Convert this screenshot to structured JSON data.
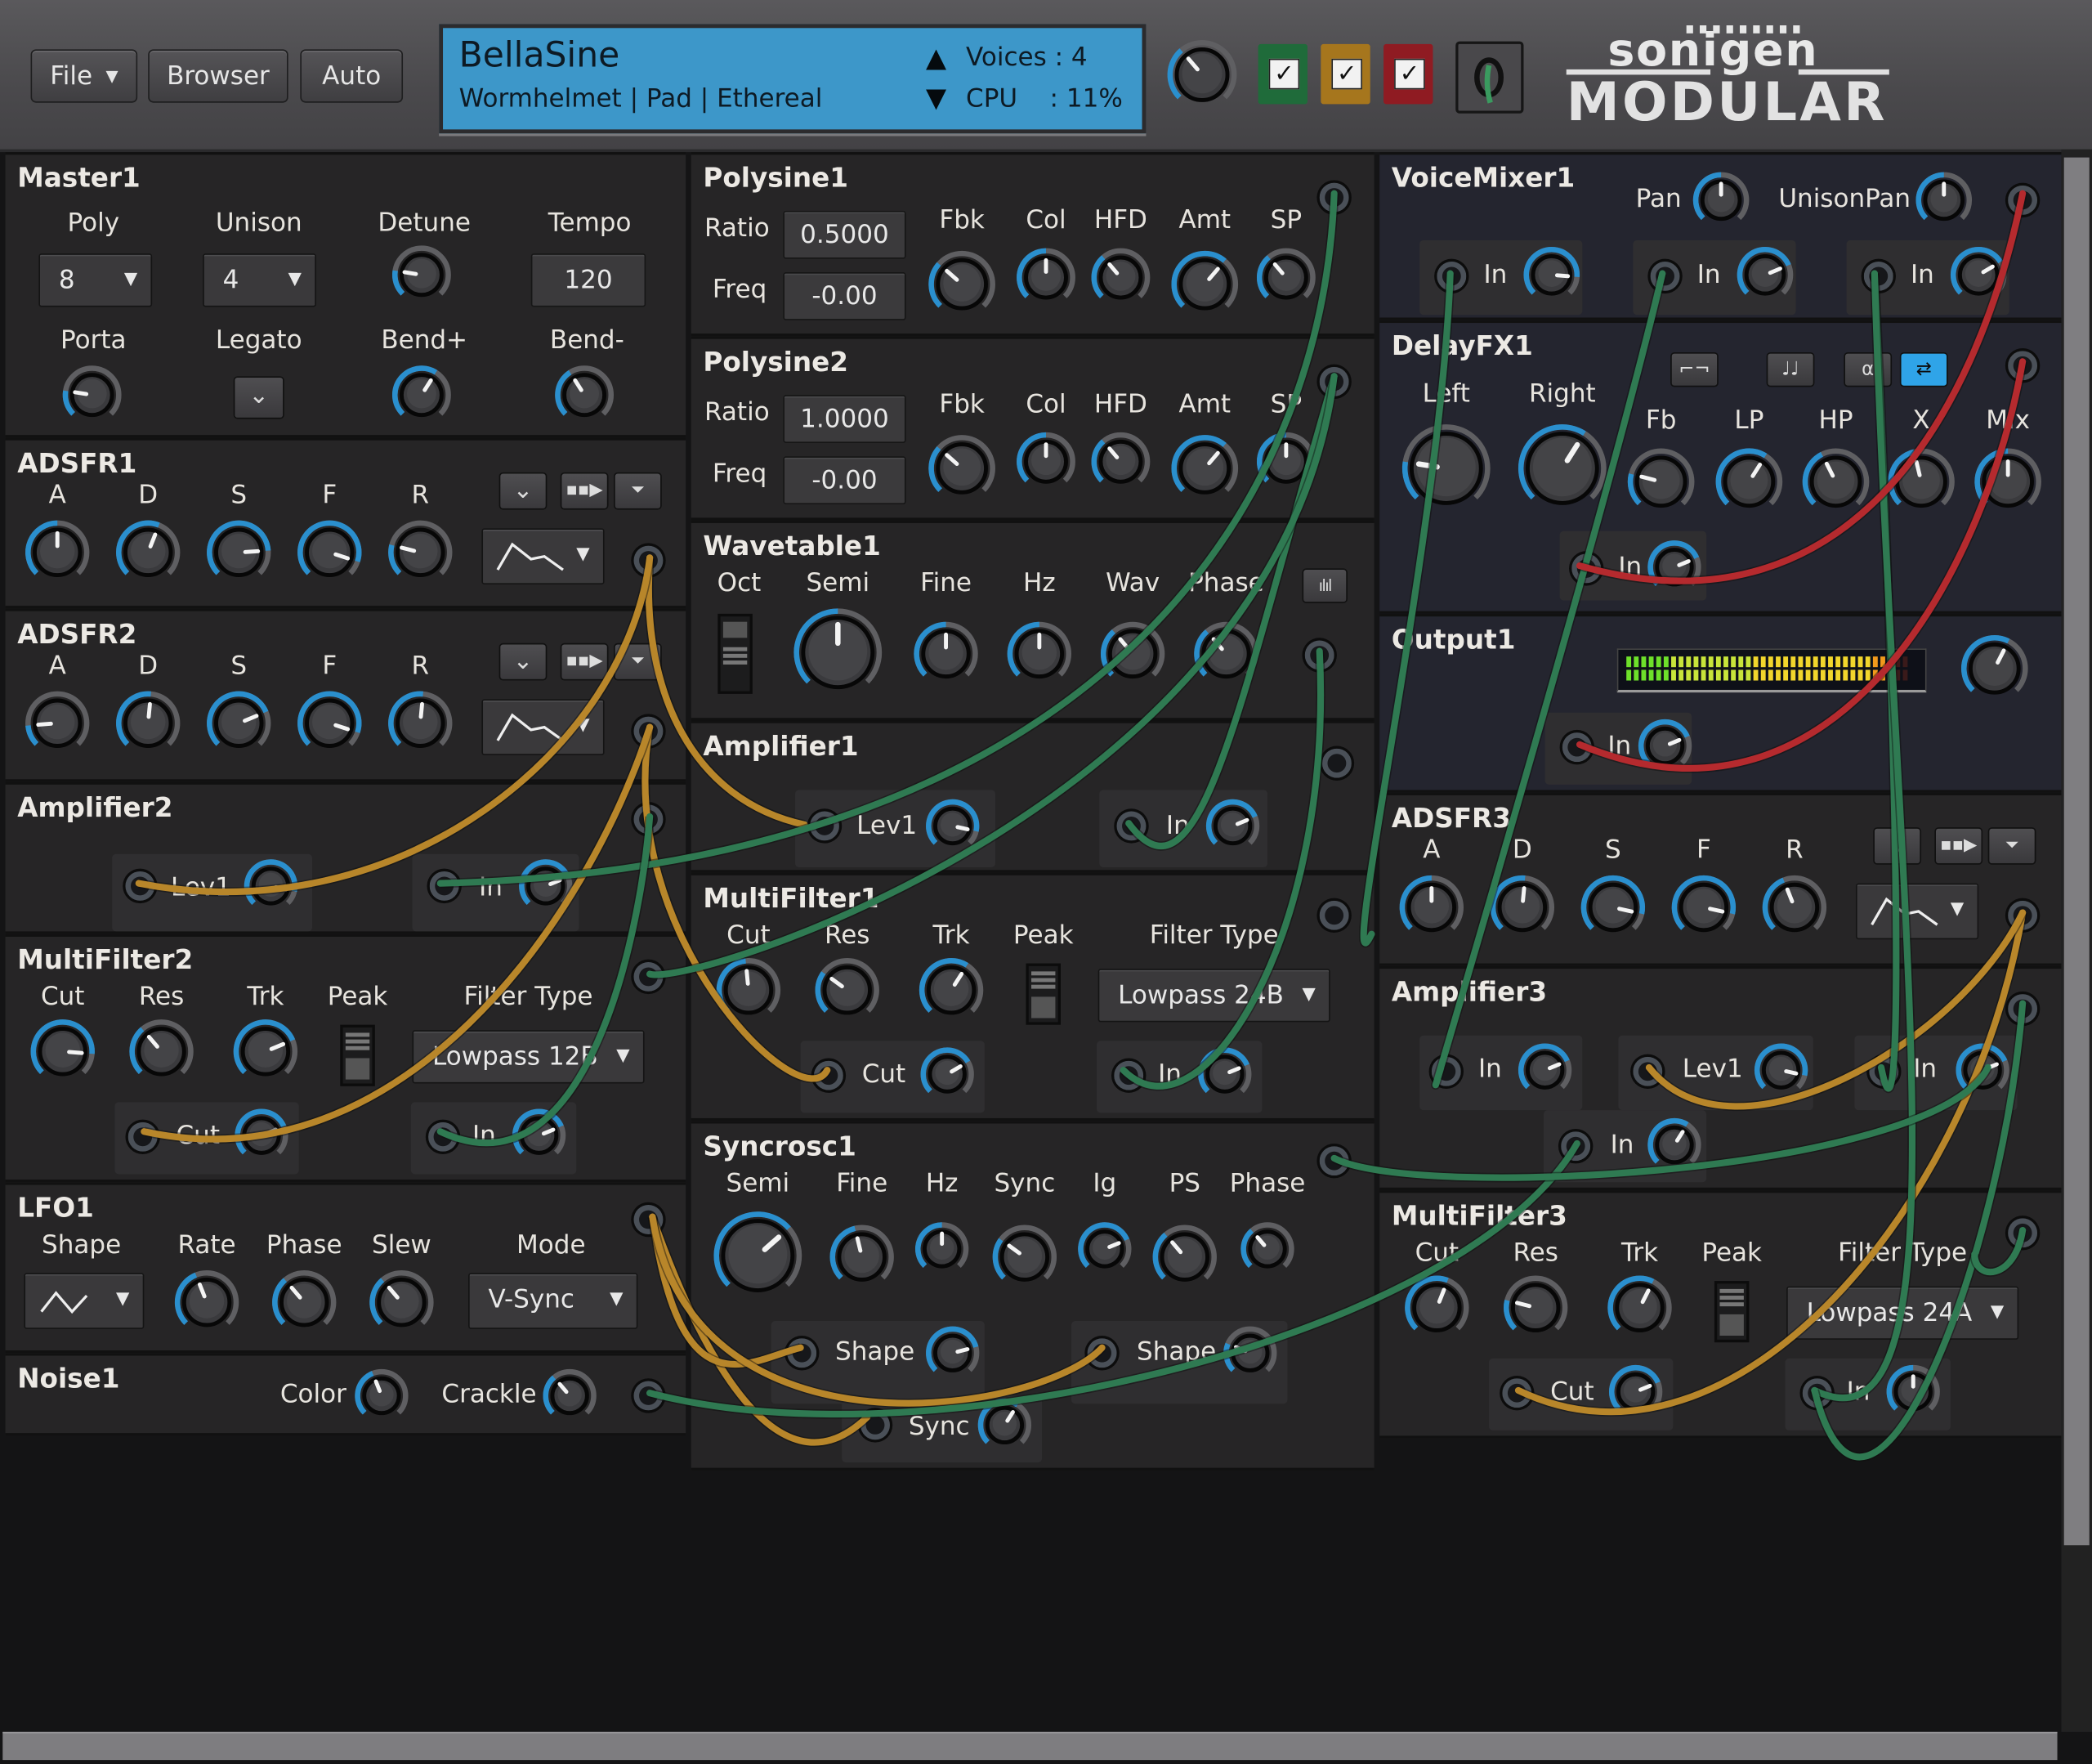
{
  "header": {
    "file_label": "File",
    "browser_label": "Browser",
    "auto_label": "Auto",
    "preset_name": "BellaSine",
    "preset_tags": "Wormhelmet | Pad | Ethereal",
    "voices_label": "Voices : 4",
    "cpu_label": "CPU    : 11%",
    "arrow_up": "▲",
    "arrow_down": "▼",
    "master_knob_value": 0.35,
    "cable_color_toggles": [
      {
        "name": "green",
        "color": "#1f6b3a",
        "checked": true
      },
      {
        "name": "yellow",
        "color": "#a6761d",
        "checked": true
      },
      {
        "name": "red",
        "color": "#8f1b22",
        "checked": true
      }
    ],
    "logo_top": "sonigen",
    "logo_bottom": "MODULAR"
  },
  "colors": {
    "accent": "#2a8fce",
    "cable_green": "#2f7a52",
    "cable_yellow": "#b8862a",
    "cable_red": "#b52a2e",
    "display_bg": "#3d97c9"
  },
  "modules": {
    "master1": {
      "title": "Master1",
      "poly_label": "Poly",
      "poly_value": "8",
      "unison_label": "Unison",
      "unison_value": "4",
      "detune_label": "Detune",
      "detune_value": 0.2,
      "tempo_label": "Tempo",
      "tempo_value": "120",
      "porta_label": "Porta",
      "porta_value": 0.2,
      "legato_label": "Legato",
      "legato_icon": "⌄",
      "bendp_label": "Bend+",
      "bendp_value": 0.62,
      "bendm_label": "Bend-",
      "bendm_value": 0.38
    },
    "adsfr1": {
      "title": "ADSFR1",
      "knobs": [
        {
          "label": "A",
          "value": 0.5
        },
        {
          "label": "D",
          "value": 0.58
        },
        {
          "label": "S",
          "value": 0.82
        },
        {
          "label": "F",
          "value": 0.9
        },
        {
          "label": "R",
          "value": 0.22
        }
      ]
    },
    "adsfr2": {
      "title": "ADSFR2",
      "knobs": [
        {
          "label": "A",
          "value": 0.15
        },
        {
          "label": "D",
          "value": 0.52
        },
        {
          "label": "S",
          "value": 0.75
        },
        {
          "label": "F",
          "value": 0.9
        },
        {
          "label": "R",
          "value": 0.52
        }
      ]
    },
    "amplifier2": {
      "title": "Amplifier2",
      "lev_label": "Lev1",
      "lev_value": 0.88,
      "in_label": "In",
      "in_value": 0.75
    },
    "multifilter2": {
      "title": "MultiFilter2",
      "knobs": [
        {
          "label": "Cut",
          "value": 0.85
        },
        {
          "label": "Res",
          "value": 0.35
        },
        {
          "label": "Trk",
          "value": 0.75
        }
      ],
      "peak_label": "Peak",
      "type_label": "Filter Type",
      "type_value": "Lowpass 12B",
      "cut_label": "Cut",
      "cut_value": 0.75,
      "in_label": "In",
      "in_value": 0.75
    },
    "lfo1": {
      "title": "LFO1",
      "shape_label": "Shape",
      "knobs": [
        {
          "label": "Rate",
          "value": 0.42
        },
        {
          "label": "Phase",
          "value": 0.35
        },
        {
          "label": "Slew",
          "value": 0.35
        }
      ],
      "mode_label": "Mode",
      "mode_value": "V-Sync"
    },
    "noise1": {
      "title": "Noise1",
      "color_label": "Color",
      "color_value": 0.42,
      "crackle_label": "Crackle",
      "crackle_value": 0.35
    },
    "polysine1": {
      "title": "Polysine1",
      "ratio_label": "Ratio",
      "ratio_value": "0.5000",
      "freq_label": "Freq",
      "freq_value": "-0.00",
      "knobs": [
        {
          "label": "Fbk",
          "value": 0.32
        },
        {
          "label": "Col",
          "value": 0.5
        },
        {
          "label": "HFD",
          "value": 0.35
        },
        {
          "label": "Amt",
          "value": 0.65
        },
        {
          "label": "SP",
          "value": 0.35
        }
      ]
    },
    "polysine2": {
      "title": "Polysine2",
      "ratio_label": "Ratio",
      "ratio_value": "1.0000",
      "freq_label": "Freq",
      "freq_value": "-0.00",
      "knobs": [
        {
          "label": "Fbk",
          "value": 0.32
        },
        {
          "label": "Col",
          "value": 0.5
        },
        {
          "label": "HFD",
          "value": 0.35
        },
        {
          "label": "Amt",
          "value": 0.65
        },
        {
          "label": "SP",
          "value": 0.5
        }
      ]
    },
    "wavetable1": {
      "title": "Wavetable1",
      "oct_label": "Oct",
      "knobs": [
        {
          "label": "Semi",
          "value": 0.5
        },
        {
          "label": "Fine",
          "value": 0.5
        },
        {
          "label": "Hz",
          "value": 0.5
        },
        {
          "label": "Wav",
          "value": 0.35
        },
        {
          "label": "Phase",
          "value": 0.35
        }
      ],
      "spectrum_icon": "ılıl"
    },
    "amplifier1": {
      "title": "Amplifier1",
      "lev_label": "Lev1",
      "lev_value": 0.88,
      "in_label": "In",
      "in_value": 0.75
    },
    "multifilter1": {
      "title": "MultiFilter1",
      "knobs": [
        {
          "label": "Cut",
          "value": 0.48
        },
        {
          "label": "Res",
          "value": 0.3
        },
        {
          "label": "Trk",
          "value": 0.62
        }
      ],
      "peak_label": "Peak",
      "type_label": "Filter Type",
      "type_value": "Lowpass 24B",
      "cut_label": "Cut",
      "cut_value": 0.72,
      "in_label": "In",
      "in_value": 0.75
    },
    "syncrosc1": {
      "title": "Syncrosc1",
      "knobs": [
        {
          "label": "Semi",
          "value": 0.68
        },
        {
          "label": "Fine",
          "value": 0.45
        },
        {
          "label": "Hz",
          "value": 0.5
        },
        {
          "label": "Sync",
          "value": 0.3
        },
        {
          "label": "Ig",
          "value": 0.75
        },
        {
          "label": "PS",
          "value": 0.35
        },
        {
          "label": "Phase",
          "value": 0.35
        }
      ],
      "shape1_label": "Shape",
      "shape1_value": 0.78,
      "shape2_label": "Shape",
      "shape2_value": 0.25,
      "sync_label": "Sync",
      "sync_value": 0.62
    },
    "voicemixer1": {
      "title": "VoiceMixer1",
      "pan_label": "Pan",
      "pan_value": 0.5,
      "unisonpan_label": "UnisonPan",
      "unisonpan_value": 0.5,
      "inputs": [
        {
          "label": "In",
          "value": 0.85
        },
        {
          "label": "In",
          "value": 0.75
        },
        {
          "label": "In",
          "value": 0.72
        }
      ]
    },
    "delayfx1": {
      "title": "DelayFX1",
      "buttons": [
        {
          "name": "sync-icon",
          "glyph": "⌐¬",
          "active": false
        },
        {
          "name": "notes-icon",
          "glyph": "♩♩",
          "active": false
        },
        {
          "name": "alpha-icon",
          "glyph": "α",
          "active": false
        },
        {
          "name": "swap-icon",
          "glyph": "⇄",
          "active": true
        }
      ],
      "knobs_big": [
        {
          "label": "Left",
          "value": 0.2
        },
        {
          "label": "Right",
          "value": 0.62
        }
      ],
      "knobs": [
        {
          "label": "Fb",
          "value": 0.22
        },
        {
          "label": "LP",
          "value": 0.62
        },
        {
          "label": "HP",
          "value": 0.4
        },
        {
          "label": "X",
          "value": 0.45
        },
        {
          "label": "Mix",
          "value": 0.5
        }
      ],
      "in_label": "In",
      "in_value": 0.75
    },
    "output1": {
      "title": "Output1",
      "meter_level": 0.93,
      "volume_value": 0.6,
      "in_label": "In",
      "in_value": 0.75
    },
    "adsfr3": {
      "title": "ADSFR3",
      "knobs": [
        {
          "label": "A",
          "value": 0.5
        },
        {
          "label": "D",
          "value": 0.52
        },
        {
          "label": "S",
          "value": 0.88
        },
        {
          "label": "F",
          "value": 0.88
        },
        {
          "label": "R",
          "value": 0.42
        }
      ]
    },
    "amplifier3": {
      "title": "Amplifier3",
      "in1_label": "In",
      "in1_value": 0.75,
      "lev_label": "Lev1",
      "lev_value": 0.88,
      "in2_label": "In",
      "in2_value": 0.75,
      "in3_label": "In",
      "in3_value": 0.62
    },
    "multifilter3": {
      "title": "MultiFilter3",
      "knobs": [
        {
          "label": "Cut",
          "value": 0.58
        },
        {
          "label": "Res",
          "value": 0.22
        },
        {
          "label": "Trk",
          "value": 0.6
        }
      ],
      "peak_label": "Peak",
      "type_label": "Filter Type",
      "type_value": "Lowpass 24A",
      "cut_label": "Cut",
      "cut_value": 0.75,
      "in_label": "In",
      "in_value": 0.5
    }
  }
}
